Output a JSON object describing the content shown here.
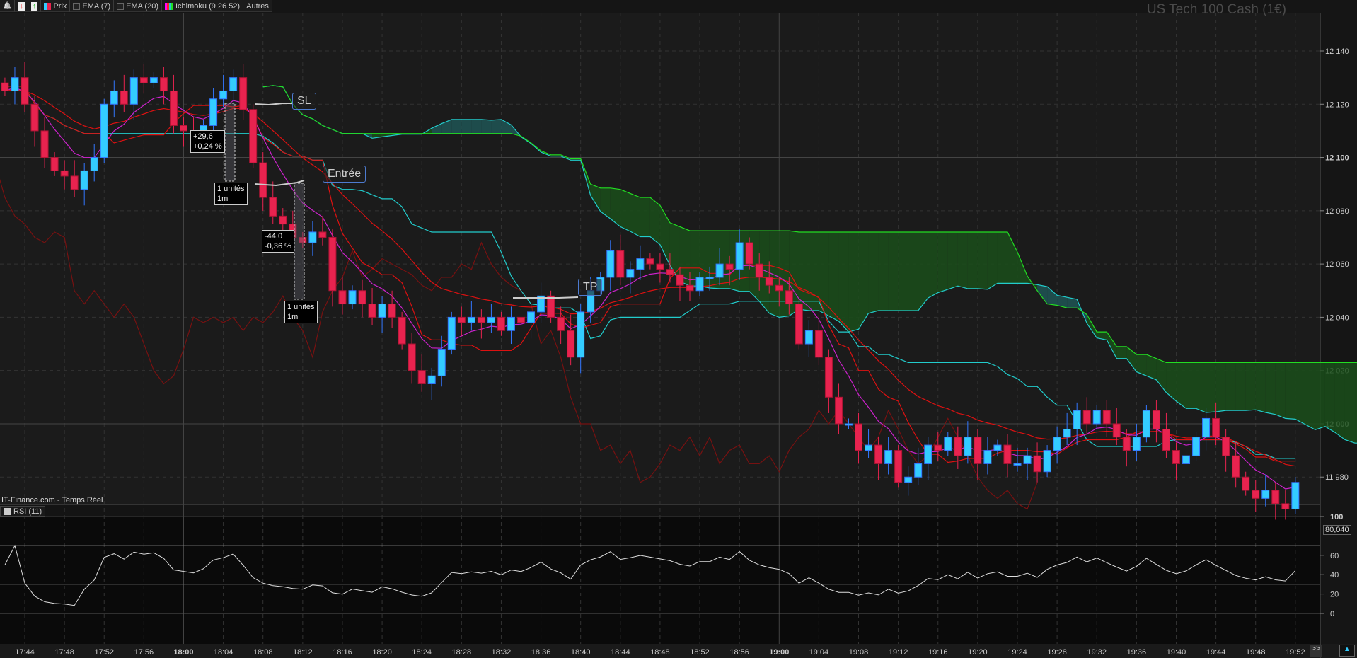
{
  "toolbar": {
    "items": [
      {
        "label": "",
        "icon": "bell-icon"
      },
      {
        "label": "",
        "icon": "sell-order-icon"
      },
      {
        "label": "",
        "icon": "buy-order-icon"
      },
      {
        "label": "Prix",
        "icon": "price-swatch-icon"
      },
      {
        "label": "EMA (7)",
        "icon": "checkbox-icon"
      },
      {
        "label": "EMA (20)",
        "icon": "checkbox-icon"
      },
      {
        "label": "Ichimoku (9 26 52)",
        "icon": "ichimoku-swatch-icon"
      },
      {
        "label": "Autres",
        "icon": ""
      }
    ]
  },
  "title": "US Tech 100 Cash (1€)",
  "source": "IT-Finance.com - Temps Réel",
  "rsi": {
    "label": "RSI (11)",
    "value_label": "80,040",
    "ticks": [
      "100",
      "60",
      "40",
      "20",
      "0"
    ],
    "tick_values": [
      100,
      60,
      40,
      20,
      0
    ]
  },
  "price_axis": {
    "ticks": [
      "12 140",
      "12 120",
      "12 100",
      "12 080",
      "12 060",
      "12 040",
      "12 020",
      "12 000",
      "11 980"
    ],
    "values": [
      12140,
      12120,
      12100,
      12080,
      12060,
      12040,
      12020,
      12000,
      11980
    ]
  },
  "time_axis": {
    "labels": [
      "17:44",
      "17:48",
      "17:52",
      "17:56",
      "18:00",
      "18:04",
      "18:08",
      "18:12",
      "18:16",
      "18:20",
      "18:24",
      "18:28",
      "18:32",
      "18:36",
      "18:40",
      "18:44",
      "18:48",
      "18:52",
      "18:56",
      "19:00",
      "19:04",
      "19:08",
      "19:12",
      "19:16",
      "19:20",
      "19:24",
      "19:28",
      "19:32",
      "19:36",
      "19:40",
      "19:44",
      "19:48",
      "19:52"
    ],
    "more_label": ">>"
  },
  "orders": {
    "sl": "SL",
    "entry": "Entrée",
    "tp": "TP"
  },
  "annotations": [
    {
      "line1": "+29,6",
      "line2": "+0,24 %"
    },
    {
      "line1": "1 unités",
      "line2": "1m"
    },
    {
      "line1": "-44,0",
      "line2": "-0,36 %"
    },
    {
      "line1": "1 unités",
      "line2": "1m"
    }
  ],
  "colors": {
    "up": "#33ccff",
    "down": "#e8234f",
    "ema7": "#cc22cc",
    "ema20": "#dd1111",
    "tenkan": "#dd1111",
    "kijun": "#22cccc",
    "span_a": "#22cccc",
    "span_b": "#22dd22",
    "chikou": "#771111"
  },
  "series": {
    "start_minute": -2,
    "closes": [
      12125,
      12130,
      12120,
      12110,
      12100,
      12095,
      12093,
      12088,
      12095,
      12100,
      12120,
      12125,
      12120,
      12130,
      12128,
      12130,
      12125,
      12112,
      12110,
      12108,
      12112,
      12122,
      12125,
      12130,
      12118,
      12098,
      12085,
      12078,
      12075,
      12070,
      12068,
      12072,
      12070,
      12050,
      12045,
      12050,
      12045,
      12040,
      12045,
      12040,
      12030,
      12020,
      12015,
      12018,
      12028,
      12040,
      12038,
      12040,
      12038,
      12040,
      12035,
      12040,
      12038,
      12042,
      12048,
      12040,
      12035,
      12025,
      12042,
      12050,
      12055,
      12065,
      12055,
      12058,
      12062,
      12060,
      12058,
      12056,
      12052,
      12050,
      12055,
      12055,
      12060,
      12058,
      12068,
      12060,
      12055,
      12052,
      12050,
      12045,
      12030,
      12035,
      12025,
      12010,
      12000,
      12000,
      11990,
      11992,
      11985,
      11990,
      11978,
      11980,
      11985,
      11992,
      11990,
      11995,
      11988,
      11995,
      11985,
      11990,
      11992,
      11985,
      11985,
      11988,
      11982,
      11990,
      11995,
      11998,
      12005,
      12000,
      12005,
      12000,
      11995,
      11990,
      11995,
      12005,
      11998,
      11990,
      11985,
      11988,
      11995,
      12002,
      11995,
      11988,
      11980,
      11975,
      11972,
      11975,
      11970,
      11968,
      11978
    ]
  }
}
